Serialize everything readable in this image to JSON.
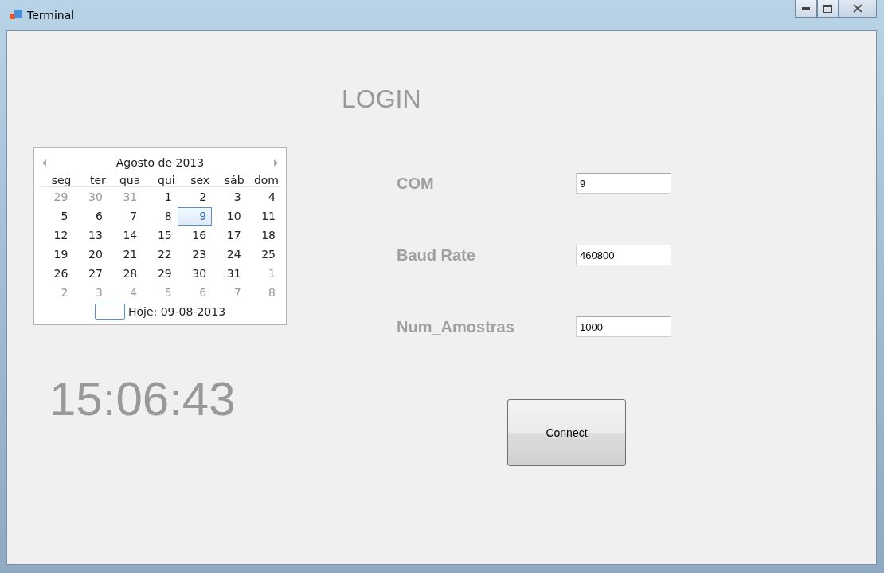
{
  "window": {
    "title": "Terminal"
  },
  "heading": "LOGIN",
  "calendar": {
    "month": "Agosto de 2013",
    "weekdays": [
      "seg",
      "ter",
      "qua",
      "qui",
      "sex",
      "sáb",
      "dom"
    ],
    "weeks": [
      [
        {
          "day": "29",
          "muted": true,
          "selected": false
        },
        {
          "day": "30",
          "muted": true,
          "selected": false
        },
        {
          "day": "31",
          "muted": true,
          "selected": false
        },
        {
          "day": "1",
          "muted": false,
          "selected": false
        },
        {
          "day": "2",
          "muted": false,
          "selected": false
        },
        {
          "day": "3",
          "muted": false,
          "selected": false
        },
        {
          "day": "4",
          "muted": false,
          "selected": false
        }
      ],
      [
        {
          "day": "5",
          "muted": false,
          "selected": false
        },
        {
          "day": "6",
          "muted": false,
          "selected": false
        },
        {
          "day": "7",
          "muted": false,
          "selected": false
        },
        {
          "day": "8",
          "muted": false,
          "selected": false
        },
        {
          "day": "9",
          "muted": false,
          "selected": true
        },
        {
          "day": "10",
          "muted": false,
          "selected": false
        },
        {
          "day": "11",
          "muted": false,
          "selected": false
        }
      ],
      [
        {
          "day": "12",
          "muted": false,
          "selected": false
        },
        {
          "day": "13",
          "muted": false,
          "selected": false
        },
        {
          "day": "14",
          "muted": false,
          "selected": false
        },
        {
          "day": "15",
          "muted": false,
          "selected": false
        },
        {
          "day": "16",
          "muted": false,
          "selected": false
        },
        {
          "day": "17",
          "muted": false,
          "selected": false
        },
        {
          "day": "18",
          "muted": false,
          "selected": false
        }
      ],
      [
        {
          "day": "19",
          "muted": false,
          "selected": false
        },
        {
          "day": "20",
          "muted": false,
          "selected": false
        },
        {
          "day": "21",
          "muted": false,
          "selected": false
        },
        {
          "day": "22",
          "muted": false,
          "selected": false
        },
        {
          "day": "23",
          "muted": false,
          "selected": false
        },
        {
          "day": "24",
          "muted": false,
          "selected": false
        },
        {
          "day": "25",
          "muted": false,
          "selected": false
        }
      ],
      [
        {
          "day": "26",
          "muted": false,
          "selected": false
        },
        {
          "day": "27",
          "muted": false,
          "selected": false
        },
        {
          "day": "28",
          "muted": false,
          "selected": false
        },
        {
          "day": "29",
          "muted": false,
          "selected": false
        },
        {
          "day": "30",
          "muted": false,
          "selected": false
        },
        {
          "day": "31",
          "muted": false,
          "selected": false
        },
        {
          "day": "1",
          "muted": true,
          "selected": false
        }
      ],
      [
        {
          "day": "2",
          "muted": true,
          "selected": false
        },
        {
          "day": "3",
          "muted": true,
          "selected": false
        },
        {
          "day": "4",
          "muted": true,
          "selected": false
        },
        {
          "day": "5",
          "muted": true,
          "selected": false
        },
        {
          "day": "6",
          "muted": true,
          "selected": false
        },
        {
          "day": "7",
          "muted": true,
          "selected": false
        },
        {
          "day": "8",
          "muted": true,
          "selected": false
        }
      ]
    ],
    "today": "Hoje: 09-08-2013"
  },
  "clock": "15:06:43",
  "fields": [
    {
      "label": "COM",
      "value": "9"
    },
    {
      "label": "Baud Rate",
      "value": "460800"
    },
    {
      "label": "Num_Amostras",
      "value": "1000"
    }
  ],
  "connect_button": "Connect"
}
